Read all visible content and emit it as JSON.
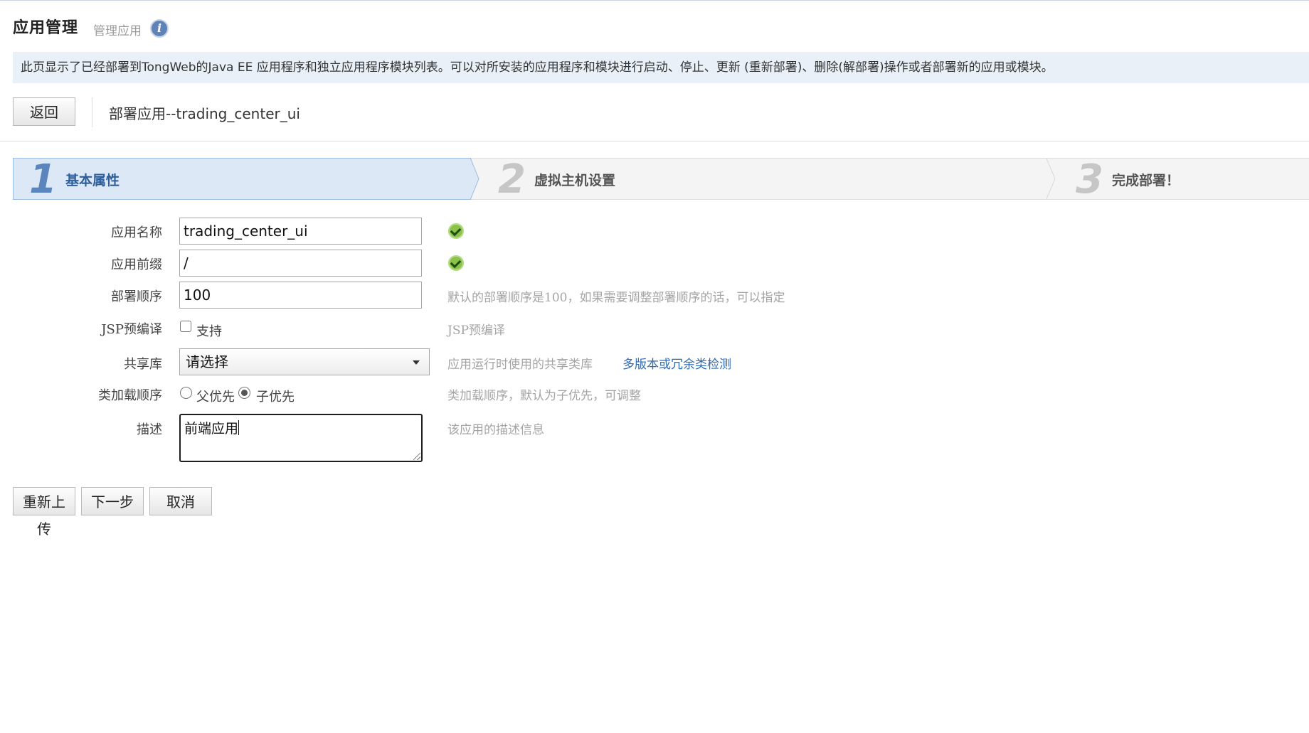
{
  "header": {
    "title": "应用管理",
    "subtitle": "管理应用",
    "info_icon": "info-icon"
  },
  "banner": {
    "text": "此页显示了已经部署到TongWeb的Java EE 应用程序和独立应用程序模块列表。可以对所安装的应用程序和模块进行启动、停止、更新 (重新部署)、删除(解部署)操作或者部署新的应用或模块。"
  },
  "toolbar": {
    "back_label": "返回",
    "breadcrumb": "部署应用--trading_center_ui"
  },
  "steps": [
    {
      "number": "1",
      "label": "基本属性",
      "active": true
    },
    {
      "number": "2",
      "label": "虚拟主机设置",
      "active": false
    },
    {
      "number": "3",
      "label": "完成部署！",
      "active": false
    }
  ],
  "form": {
    "app_name": {
      "label": "应用名称",
      "value": "trading_center_ui",
      "status_icon": "check-icon"
    },
    "app_prefix": {
      "label": "应用前缀",
      "value": "/",
      "status_icon": "check-icon"
    },
    "deploy_order": {
      "label": "部署顺序",
      "value": "100",
      "hint": "默认的部署顺序是100，如果需要调整部署顺序的话，可以指定"
    },
    "jsp_precompile": {
      "label": "JSP预编译",
      "checkbox_label": "支持",
      "checked": false,
      "hint": "JSP预编译"
    },
    "shared_lib": {
      "label": "共享库",
      "selected": "请选择",
      "hint": "应用运行时使用的共享类库",
      "link": "多版本或冗余类检测"
    },
    "class_load_order": {
      "label": "类加载顺序",
      "options": [
        "父优先",
        "子优先"
      ],
      "selected": "子优先",
      "hint": "类加载顺序，默认为子优先，可调整"
    },
    "description": {
      "label": "描述",
      "value": "前端应用",
      "hint": "该应用的描述信息"
    }
  },
  "actions": {
    "reupload_label": "重新上传",
    "next_label": "下一步",
    "cancel_label": "取消"
  },
  "colors": {
    "banner_bg": "#e9f0f8",
    "active_step_bg": "#dce8f6",
    "active_step_text": "#2e5f9a",
    "inactive_step_text": "#555555",
    "hint_text": "#a4a4a4",
    "link": "#2f6bb3",
    "ok_green": "#8bc34a"
  }
}
